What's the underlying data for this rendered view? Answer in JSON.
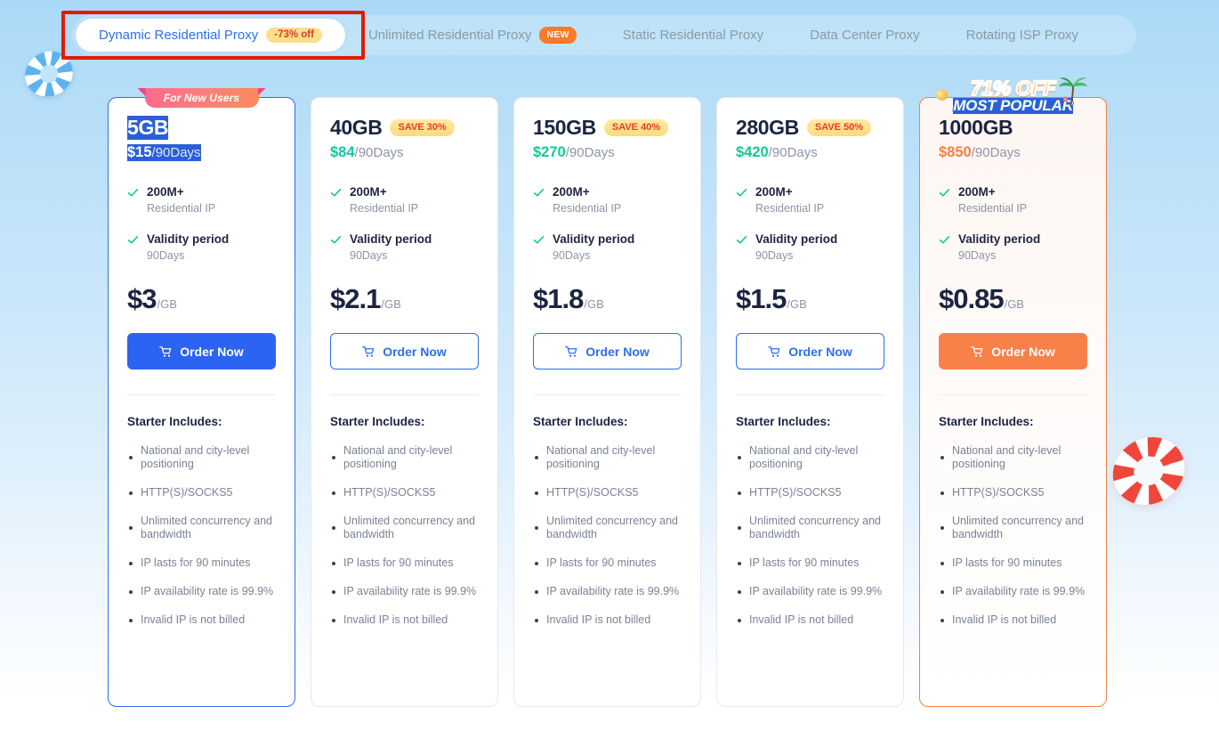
{
  "tabs": [
    {
      "label": "Dynamic Residential Proxy",
      "badge": "-73% off",
      "badge_kind": "off",
      "active": true
    },
    {
      "label": "Unlimited Residential Proxy",
      "badge": "NEW",
      "badge_kind": "new",
      "active": false
    },
    {
      "label": "Static Residential Proxy",
      "badge": "",
      "badge_kind": "",
      "active": false
    },
    {
      "label": "Data Center Proxy",
      "badge": "",
      "badge_kind": "",
      "active": false
    },
    {
      "label": "Rotating ISP Proxy",
      "badge": "",
      "badge_kind": "",
      "active": false
    }
  ],
  "decorations": {
    "ring_left": "life-ring-blue",
    "ring_right": "life-ring-red",
    "highlight_box": "red-annotation-rectangle"
  },
  "colors": {
    "accent_blue": "#2c6ef2",
    "accent_orange": "#f8814a",
    "price_green": "#11c999",
    "badge_yellow": "#fbdc7b",
    "badge_red_text": "#ea3a2c",
    "check_green": "#16c79a",
    "text_dark": "#1d2442",
    "text_muted": "#8d94a6",
    "selection_blue": "#2b5fd9"
  },
  "cards": [
    {
      "ribbon": "For New Users",
      "size": "5GB",
      "save_badge": "",
      "price": "$15",
      "period": "/90Days",
      "selected_text": true,
      "features": [
        {
          "title": "200M+",
          "sub": "Residential IP"
        },
        {
          "title": "Validity period",
          "sub": "90Days"
        }
      ],
      "unit_price": "$3",
      "unit_suffix": "/GB",
      "button_label": "Order Now",
      "button_style": "solid-blue",
      "includes_title": "Starter Includes:",
      "includes": [
        "National and city-level positioning",
        "HTTP(S)/SOCKS5",
        "Unlimited concurrency and bandwidth",
        "IP lasts for 90 minutes",
        "IP availability rate is 99.9%",
        "Invalid IP is not billed"
      ]
    },
    {
      "ribbon": "",
      "size": "40GB",
      "save_badge": "SAVE 30%",
      "price": "$84",
      "period": "/90Days",
      "selected_text": false,
      "features": [
        {
          "title": "200M+",
          "sub": "Residential IP"
        },
        {
          "title": "Validity period",
          "sub": "90Days"
        }
      ],
      "unit_price": "$2.1",
      "unit_suffix": "/GB",
      "button_label": "Order Now",
      "button_style": "outline-blue",
      "includes_title": "Starter Includes:",
      "includes": [
        "National and city-level positioning",
        "HTTP(S)/SOCKS5",
        "Unlimited concurrency and bandwidth",
        "IP lasts for 90 minutes",
        "IP availability rate is 99.9%",
        "Invalid IP is not billed"
      ]
    },
    {
      "ribbon": "",
      "size": "150GB",
      "save_badge": "SAVE 40%",
      "price": "$270",
      "period": "/90Days",
      "selected_text": false,
      "features": [
        {
          "title": "200M+",
          "sub": "Residential IP"
        },
        {
          "title": "Validity period",
          "sub": "90Days"
        }
      ],
      "unit_price": "$1.8",
      "unit_suffix": "/GB",
      "button_label": "Order Now",
      "button_style": "outline-blue",
      "includes_title": "Starter Includes:",
      "includes": [
        "National and city-level positioning",
        "HTTP(S)/SOCKS5",
        "Unlimited concurrency and bandwidth",
        "IP lasts for 90 minutes",
        "IP availability rate is 99.9%",
        "Invalid IP is not billed"
      ]
    },
    {
      "ribbon": "",
      "size": "280GB",
      "save_badge": "SAVE 50%",
      "price": "$420",
      "period": "/90Days",
      "selected_text": false,
      "features": [
        {
          "title": "200M+",
          "sub": "Residential IP"
        },
        {
          "title": "Validity period",
          "sub": "90Days"
        }
      ],
      "unit_price": "$1.5",
      "unit_suffix": "/GB",
      "button_label": "Order Now",
      "button_style": "outline-blue",
      "includes_title": "Starter Includes:",
      "includes": [
        "National and city-level positioning",
        "HTTP(S)/SOCKS5",
        "Unlimited concurrency and bandwidth",
        "IP lasts for 90 minutes",
        "IP availability rate is 99.9%",
        "Invalid IP is not billed"
      ]
    },
    {
      "ribbon": "",
      "banner_off": "71% OFF",
      "banner_most": "MOST POPULAR",
      "size": "1000GB",
      "save_badge": "",
      "price": "$850",
      "period": "/90Days",
      "selected_text": false,
      "features": [
        {
          "title": "200M+",
          "sub": "Residential IP"
        },
        {
          "title": "Validity period",
          "sub": "90Days"
        }
      ],
      "unit_price": "$0.85",
      "unit_suffix": "/GB",
      "button_label": "Order Now",
      "button_style": "solid-orange",
      "includes_title": "Starter Includes:",
      "includes": [
        "National and city-level positioning",
        "HTTP(S)/SOCKS5",
        "Unlimited concurrency and bandwidth",
        "IP lasts for 90 minutes",
        "IP availability rate is 99.9%",
        "Invalid IP is not billed"
      ]
    }
  ]
}
